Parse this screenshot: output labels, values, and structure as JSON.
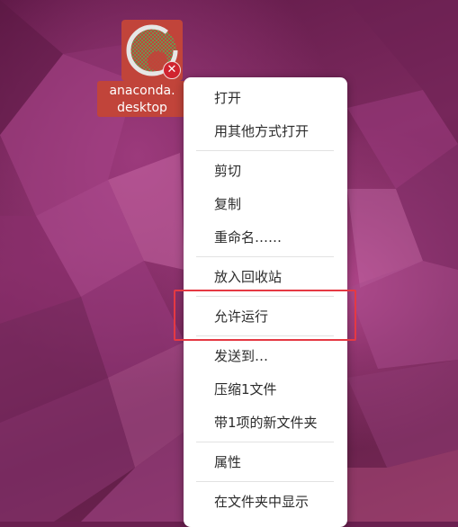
{
  "desktop": {
    "icon": {
      "name": "anaconda-icon",
      "label_line1": "anaconda.",
      "label_line2": "desktop",
      "badge_glyph": "✕",
      "tile_color": "#c1443a",
      "badge_color": "#d0232f"
    }
  },
  "menu": {
    "items": [
      {
        "label": "打开"
      },
      {
        "label": "用其他方式打开"
      },
      {
        "label": "剪切"
      },
      {
        "label": "复制"
      },
      {
        "label": "重命名……"
      },
      {
        "label": "放入回收站"
      },
      {
        "label": "允许运行"
      },
      {
        "label": "发送到…"
      },
      {
        "label": "压缩1文件"
      },
      {
        "label": "带1项的新文件夹"
      },
      {
        "label": "属性"
      },
      {
        "label": "在文件夹中显示"
      }
    ],
    "highlight_color": "#e53943"
  }
}
